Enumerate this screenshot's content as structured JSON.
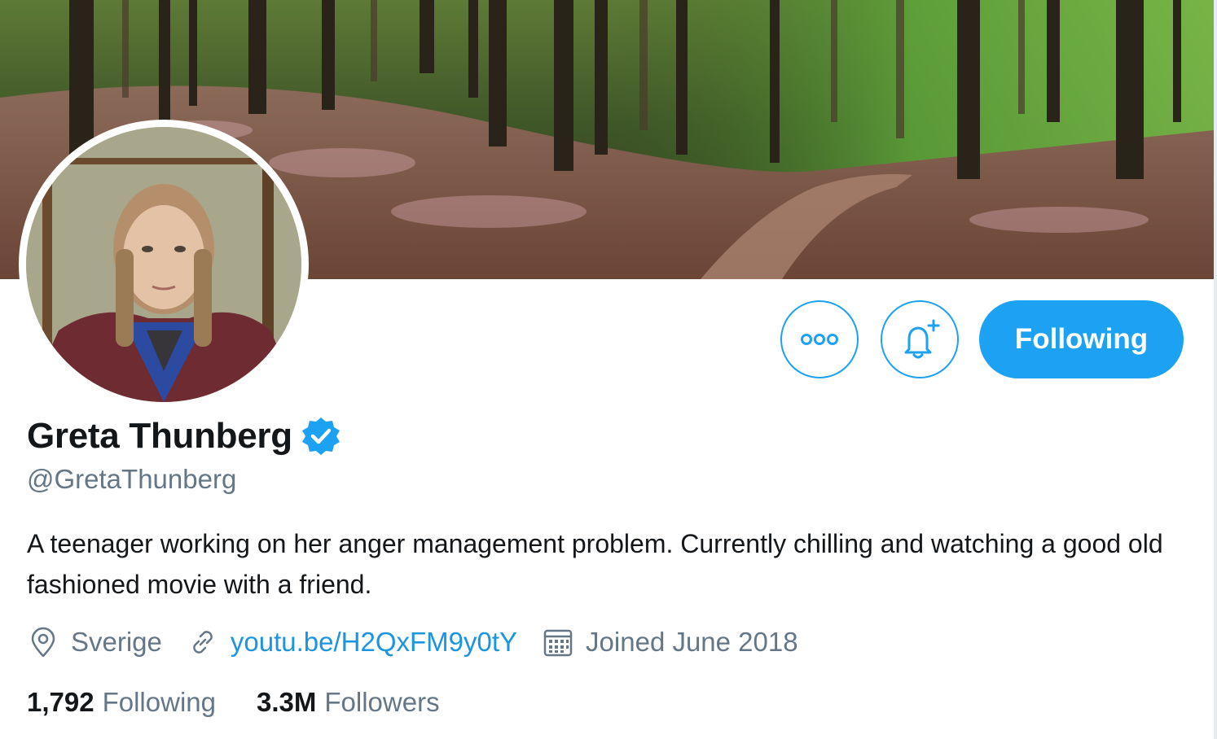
{
  "profile": {
    "name": "Greta Thunberg",
    "handle": "@GretaThunberg",
    "verified": true,
    "bio": "A teenager working on her anger management problem. Currently chilling and watching a good old fashioned movie with a friend.",
    "location": "Sverige",
    "link": "youtu.be/H2QxFM9y0tY",
    "joined": "Joined June 2018"
  },
  "actions": {
    "more_icon": "more-horizontal-icon",
    "notify_icon": "bell-plus-icon",
    "follow_label": "Following"
  },
  "stats": {
    "following_count": "1,792",
    "following_label": "Following",
    "followers_count": "3.3M",
    "followers_label": "Followers"
  },
  "icons": {
    "location": "location-pin-icon",
    "link": "link-icon",
    "calendar": "calendar-icon",
    "verified": "verified-badge-icon"
  },
  "colors": {
    "accent": "#1da1f2",
    "link": "#1b95e0",
    "secondary_text": "#657786",
    "primary_text": "#14171a"
  }
}
